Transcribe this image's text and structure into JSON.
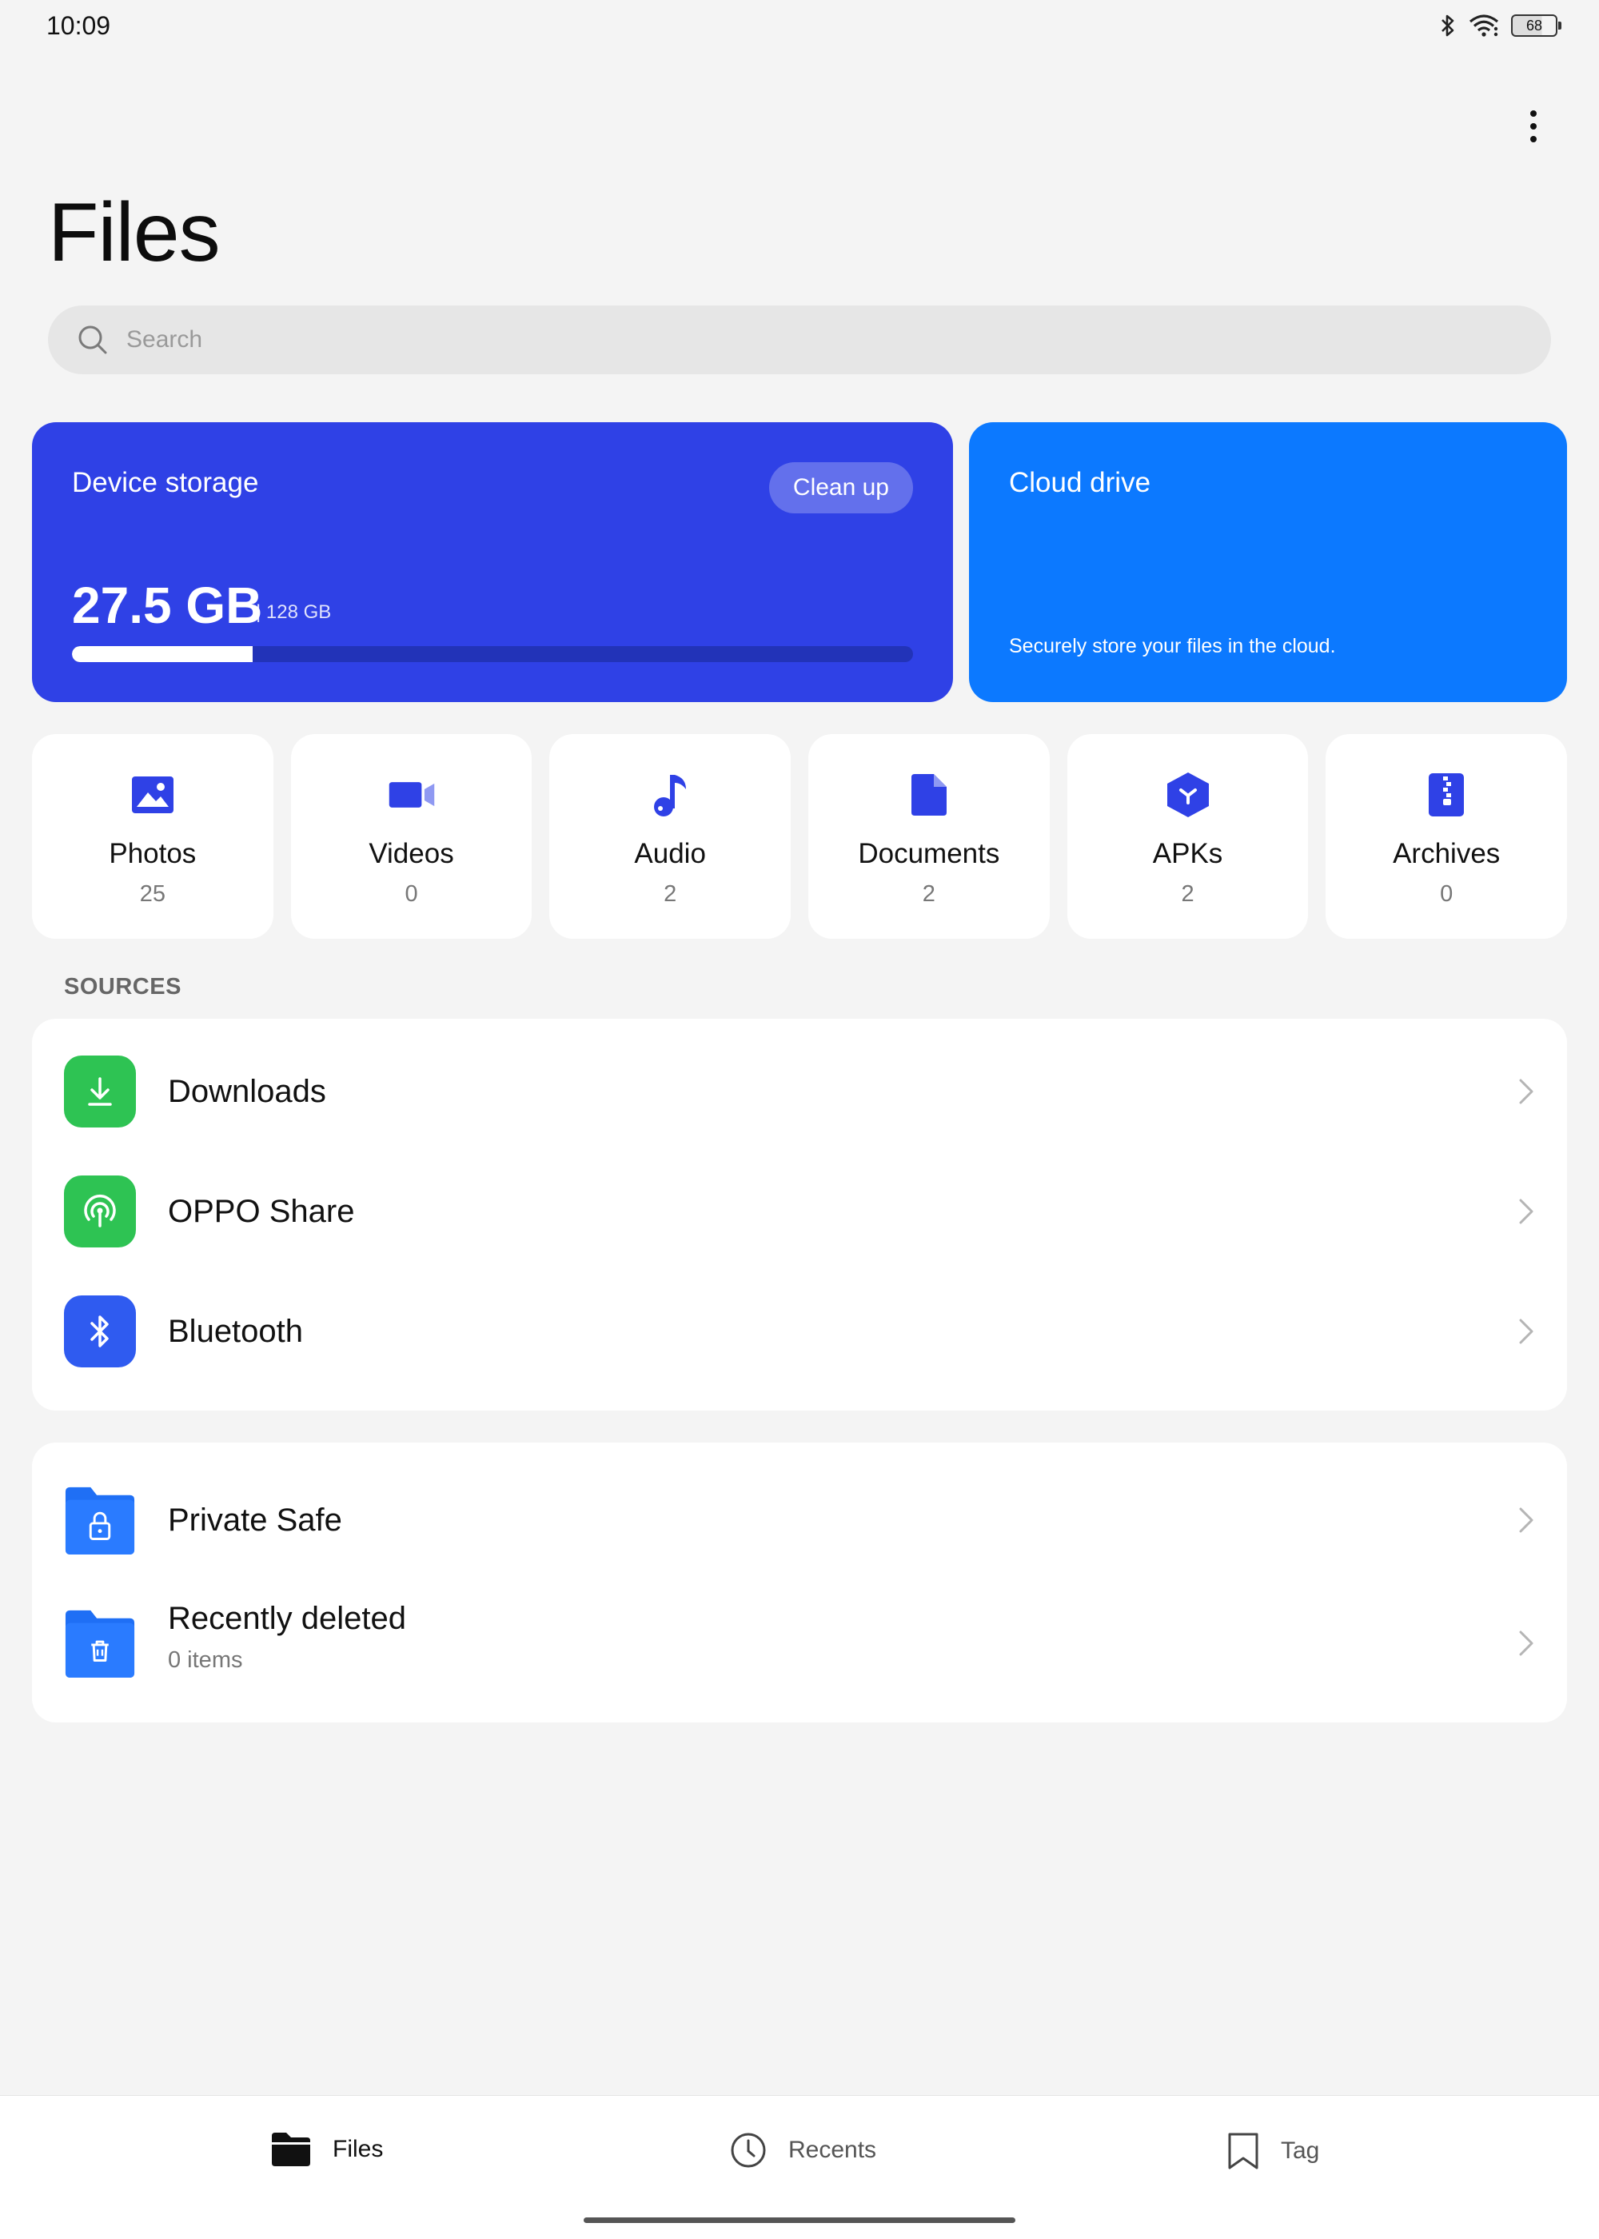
{
  "status_bar": {
    "time": "10:09",
    "battery": "68"
  },
  "header": {
    "title": "Files",
    "more_icon": "more-vertical-icon"
  },
  "search": {
    "placeholder": "Search"
  },
  "device_storage": {
    "title": "Device storage",
    "cleanup_label": "Clean up",
    "used": "27.5 GB",
    "total": "| 128 GB",
    "used_fraction": 0.215,
    "color": "#2f41e6"
  },
  "cloud_drive": {
    "title": "Cloud drive",
    "description": "Securely store your files in the cloud.",
    "color": "#0c79ff"
  },
  "categories": [
    {
      "label": "Photos",
      "count": "25",
      "icon": "photo-icon"
    },
    {
      "label": "Videos",
      "count": "0",
      "icon": "video-icon"
    },
    {
      "label": "Audio",
      "count": "2",
      "icon": "music-note-icon"
    },
    {
      "label": "Documents",
      "count": "2",
      "icon": "document-icon"
    },
    {
      "label": "APKs",
      "count": "2",
      "icon": "apk-icon"
    },
    {
      "label": "Archives",
      "count": "0",
      "icon": "archive-icon"
    }
  ],
  "sources": {
    "header": "SOURCES",
    "items": [
      {
        "label": "Downloads",
        "icon": "download-icon",
        "color": "#2ec353"
      },
      {
        "label": "OPPO Share",
        "icon": "oppo-share-icon",
        "color": "#2ec353"
      },
      {
        "label": "Bluetooth",
        "icon": "bluetooth-icon",
        "color": "#2f5bf0"
      }
    ]
  },
  "misc": {
    "items": [
      {
        "label": "Private Safe",
        "icon": "private-safe-icon",
        "color": "#1f6ff5"
      },
      {
        "label": "Recently deleted",
        "sub": "0 items",
        "icon": "trash-folder-icon",
        "color": "#1f6ff5"
      }
    ]
  },
  "bottom_nav": {
    "items": [
      {
        "label": "Files",
        "icon": "folder-icon",
        "active": true
      },
      {
        "label": "Recents",
        "icon": "clock-icon",
        "active": false
      },
      {
        "label": "Tag",
        "icon": "bookmark-icon",
        "active": false
      }
    ]
  }
}
